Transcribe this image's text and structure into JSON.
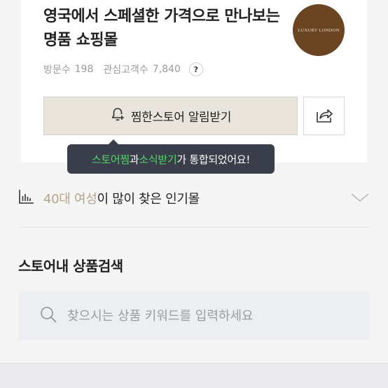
{
  "store": {
    "name": "영국에서 스페셜한 가격으로 만나보는 명품 쇼핑몰",
    "logo_text": "LUXURY LONDON",
    "logo_color": "#6b4421",
    "visitors_label": "방문수",
    "visitors_count": "198",
    "followers_label": "관심고객수",
    "followers_count": "7,840",
    "help_label": "?"
  },
  "actions": {
    "favorite_label": "찜한스토어 알림받기",
    "favorite_icon": "bell-plus-icon",
    "share_icon": "share-icon"
  },
  "tooltip": {
    "part1": "스토어찜",
    "part2": "과 ",
    "part3": "소식받기",
    "part4": "가 통합되었어요!",
    "highlight_color": "#4cd964"
  },
  "popular": {
    "icon": "bar-chart-icon",
    "demographic": "40대 여성",
    "suffix": "이 많이 찾은 인기몰",
    "expand_icon": "chevron-down-icon"
  },
  "search": {
    "title": "스토어내 상품검색",
    "placeholder": "찾으시는 상품 키워드를 입력하세요",
    "value": "",
    "icon": "search-icon"
  }
}
